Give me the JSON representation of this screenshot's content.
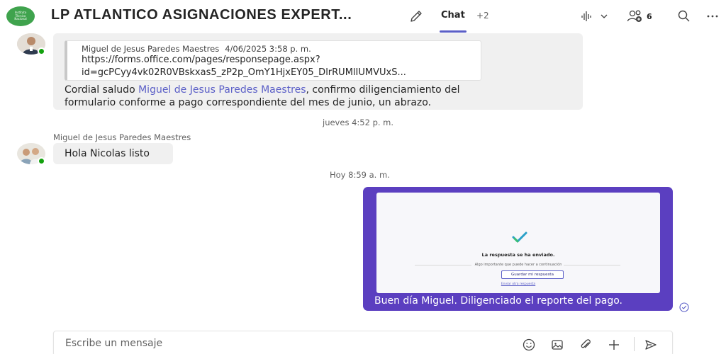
{
  "header": {
    "logo_text": "Instituto Técnico Nacional",
    "title": "LP ATLANTICO ASIGNACIONES EXPERT...",
    "tab_chat": "Chat",
    "tab_more": "+2",
    "participants_count": "6",
    "accent": "#5b5fc7"
  },
  "messages": [
    {
      "quote": {
        "author": "Miguel de Jesus Paredes Maestres",
        "date": "4/06/2025 3:58 p. m.",
        "line1": "https://forms.office.com/pages/responsepage.aspx?",
        "line2": "id=gcPCyy4vk02R0VBskxas5_zP2p_OmY1HjxEY05_DlrRUMlIUMVUxS..."
      },
      "text_prefix": "Cordial saludo ",
      "mention": "Miguel de Jesus Paredes Maestres",
      "text_suffix": ", confirmo diligenciamiento del",
      "text_line2": "formulario conforme a pago correspondiente del mes de junio, un abrazo."
    },
    {
      "timestamp": "jueves 4:52 p. m.",
      "sender": "Miguel de Jesus Paredes Maestres",
      "text": "Hola Nicolas listo"
    },
    {
      "timestamp": "Hoy 8:59 a. m.",
      "attachment": {
        "title": "La respuesta se ha enviado.",
        "subtitle": "Algo importante que puede hacer a continuación",
        "button": "Guardar mi respuesta",
        "link": "Enviar otra respuesta"
      },
      "text": "Buen día Miguel. Diligenciado el reporte del pago.",
      "bubble_color": "#5b3fc0"
    }
  ],
  "compose": {
    "placeholder": "Escribe un mensaje"
  }
}
